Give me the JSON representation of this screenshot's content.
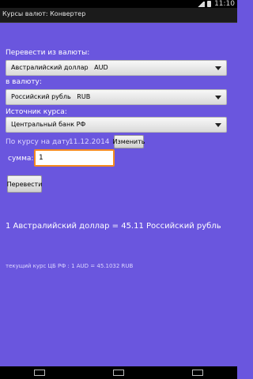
{
  "status_bar": {
    "time": "11:10"
  },
  "app": {
    "title": "Курсы валют: Конвертер"
  },
  "form": {
    "from_label": "Перевести из валюты:",
    "from_value": "Австралийский доллар   AUD",
    "to_label": "в валюту:",
    "to_value": "Российский рубль   RUB",
    "source_label": "Источник курса:",
    "source_value": "Центральный банк РФ",
    "date_label": "По курсу на дату:",
    "date_value": "11.12.2014",
    "change_button": "Изменить",
    "amount_label": "сумма:",
    "amount_value": "1",
    "convert_button": "Перевести"
  },
  "result": {
    "text": "1 Австралийский доллар = 45.11 Российский рубль"
  },
  "current_rate": {
    "text": "текущий курс ЦБ РФ : 1 AUD = 45.1032 RUB"
  },
  "colors": {
    "background": "#6a56de",
    "focus": "#f58a1f"
  }
}
